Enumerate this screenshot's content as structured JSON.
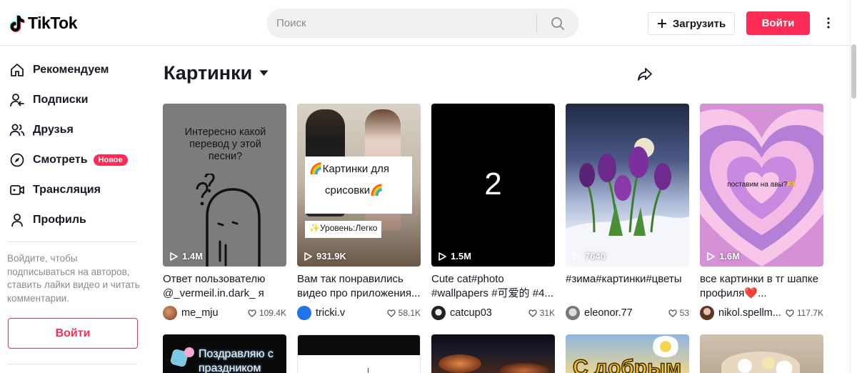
{
  "header": {
    "logo_text": "TikTok",
    "search_placeholder": "Поиск",
    "upload_label": "Загрузить",
    "login_label": "Войти"
  },
  "sidebar": {
    "items": [
      {
        "label": "Рекомендуем",
        "icon": "home-icon"
      },
      {
        "label": "Подписки",
        "icon": "following-icon"
      },
      {
        "label": "Друзья",
        "icon": "friends-icon"
      },
      {
        "label": "Смотреть",
        "icon": "explore-icon",
        "badge": "Новое"
      },
      {
        "label": "Трансляция",
        "icon": "live-icon"
      },
      {
        "label": "Профиль",
        "icon": "profile-icon"
      }
    ],
    "login_note": "Войдите, чтобы подписываться на авторов, ставить лайки видео и читать комментарии.",
    "login_label": "Войти"
  },
  "main": {
    "title": "Картинки",
    "videos": [
      {
        "views": "1.4M",
        "caption": "Ответ пользователю @_vermeil.in.dark_ я ни...",
        "author": "me_mju",
        "likes": "109.4K",
        "overlay_text": "Интересно какой перевод у этой песни?"
      },
      {
        "views": "931.9K",
        "caption": "Вам так понравились видео про приложения...",
        "author": "tricki.v",
        "likes": "58.1K",
        "overlay_line1": "🌈Картинки для",
        "overlay_line2": "срисовки🌈",
        "overlay_line3": "✨Уровень:Легко"
      },
      {
        "views": "1.5M",
        "caption": "Cute cat#photo #wallpapers #可爱的 #4...",
        "author": "catcup03",
        "likes": "31K",
        "overlay_text": "2"
      },
      {
        "views": "7640",
        "caption": "#зима#картинки#цветы",
        "author": "eleonor.77",
        "likes": "53"
      },
      {
        "views": "1.6M",
        "caption": "все картинки в тг шапке профиля❤️...",
        "author": "nikol.spellm...",
        "likes": "117.7K",
        "overlay_text": "поставим на авы?🫶"
      }
    ],
    "row2": [
      {
        "overlay_text": "Поздравляю с праздником"
      },
      {
        "overlay_text": ""
      },
      {
        "overlay_text": ""
      },
      {
        "overlay_text": "С добрым"
      },
      {
        "overlay_text": ""
      }
    ]
  },
  "colors": {
    "accent": "#fe2c55",
    "text": "#161823",
    "muted": "#8a8b91"
  }
}
